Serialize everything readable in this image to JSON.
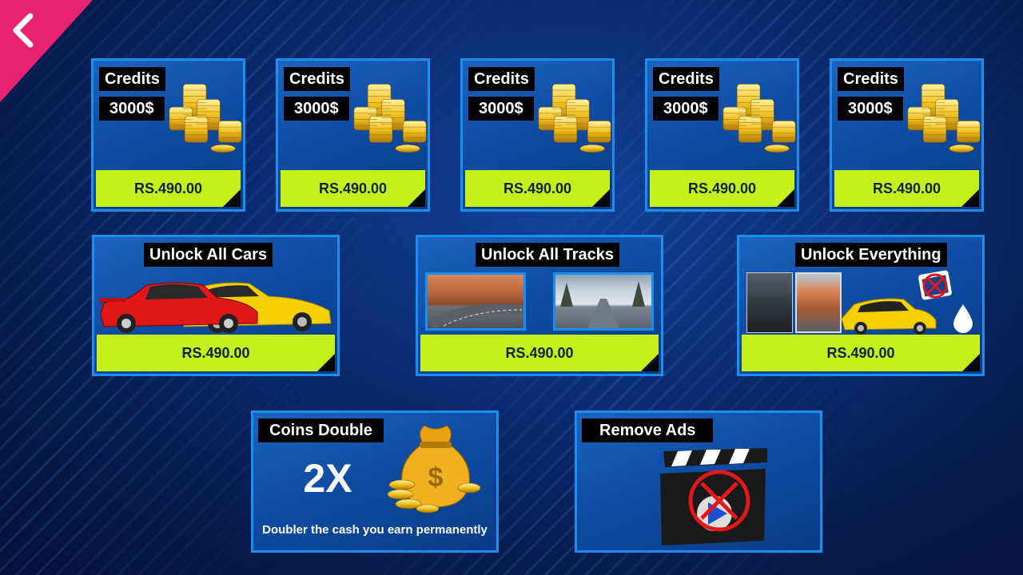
{
  "credits_packs": [
    {
      "title": "Credits",
      "amount": "3000$",
      "price": "RS.490.00"
    },
    {
      "title": "Credits",
      "amount": "3000$",
      "price": "RS.490.00"
    },
    {
      "title": "Credits",
      "amount": "3000$",
      "price": "RS.490.00"
    },
    {
      "title": "Credits",
      "amount": "3000$",
      "price": "RS.490.00"
    },
    {
      "title": "Credits",
      "amount": "3000$",
      "price": "RS.490.00"
    }
  ],
  "unlock_cars": {
    "title": "Unlock All Cars",
    "price": "RS.490.00"
  },
  "unlock_tracks": {
    "title": "Unlock All Tracks",
    "price": "RS.490.00"
  },
  "unlock_everything": {
    "title": "Unlock Everything",
    "price": "RS.490.00"
  },
  "coins_double": {
    "title": "Coins Double",
    "multiplier": "2X",
    "description": "Doubler the cash you earn permanently"
  },
  "remove_ads": {
    "title": "Remove Ads"
  },
  "colors": {
    "accent_green": "#c5f01b",
    "card_border": "#1c8ef0",
    "back_pink": "#e8226e"
  },
  "icons": {
    "back": "chevron-left-icon",
    "coins": "coin-stack-icon",
    "bag": "money-bag-icon",
    "clapper": "clapperboard-no-ads-icon"
  }
}
